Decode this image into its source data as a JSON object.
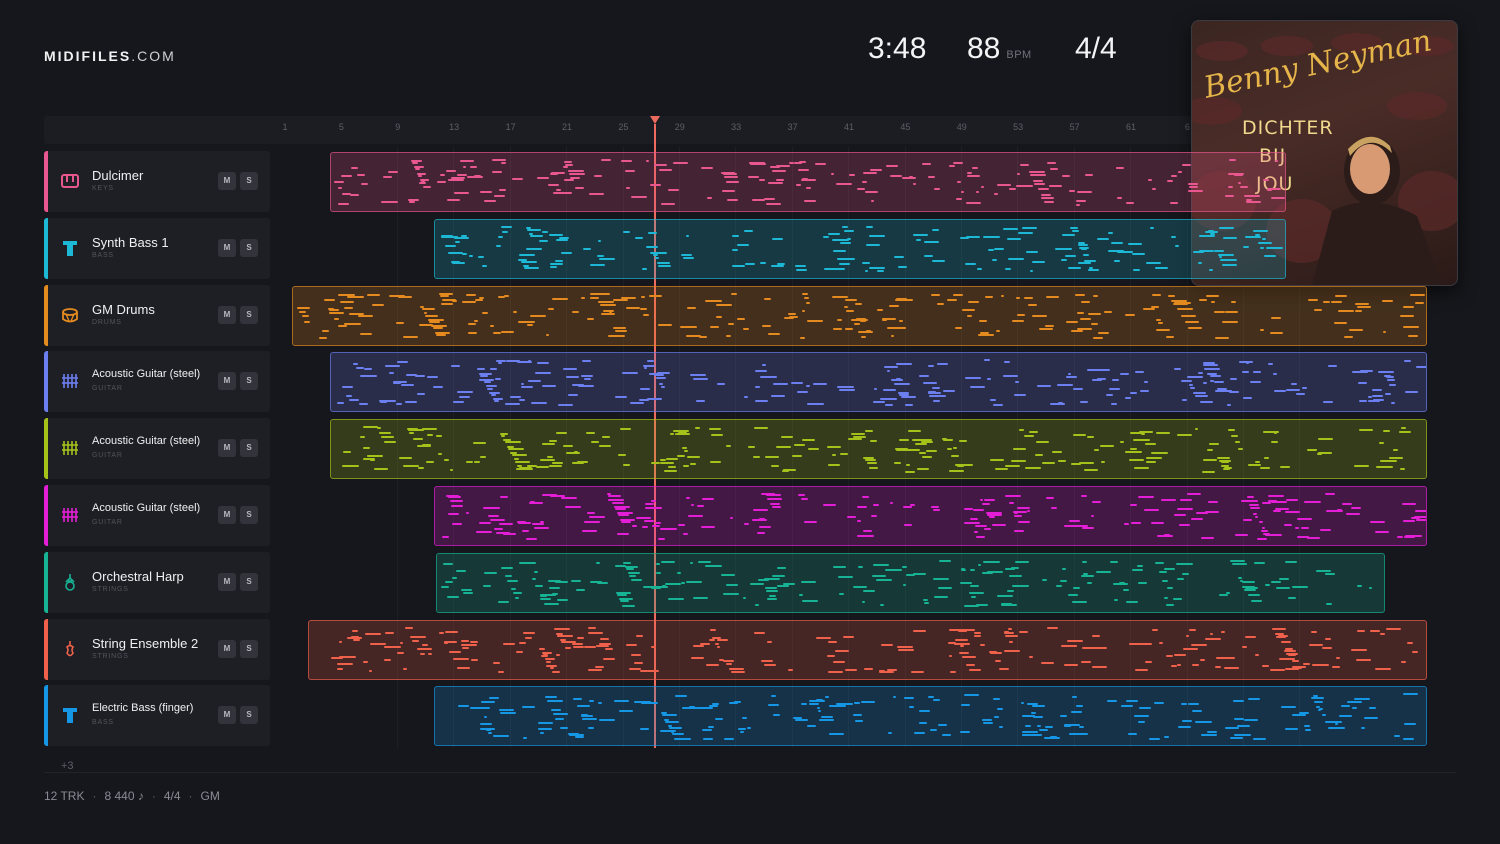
{
  "brand": {
    "bold": "MIDIFILES",
    "light": ".COM"
  },
  "transport": {
    "time": "3:48",
    "tempo": "88",
    "tempo_unit": "BPM",
    "meter": "4/4"
  },
  "ruler": {
    "bars": [
      "1",
      "5",
      "9",
      "13",
      "17",
      "21",
      "25",
      "29",
      "33",
      "37",
      "41",
      "45",
      "49",
      "53",
      "57",
      "61",
      "6"
    ]
  },
  "playhead_bar": 27,
  "tracks": [
    {
      "name": "Dulcimer",
      "category": "KEYS",
      "color": "#e8578f",
      "icon": "piano-icon",
      "mute": "M",
      "solo": "S"
    },
    {
      "name": "Synth Bass 1",
      "category": "BASS",
      "color": "#1cb8d6",
      "icon": "bass-icon",
      "mute": "M",
      "solo": "S"
    },
    {
      "name": "GM Drums",
      "category": "DRUMS",
      "color": "#e48a1f",
      "icon": "drum-icon",
      "mute": "M",
      "solo": "S"
    },
    {
      "name": "Acoustic Guitar (steel)",
      "category": "GUITAR",
      "color": "#6c7ff0",
      "icon": "guitar-icon",
      "mute": "M",
      "solo": "S"
    },
    {
      "name": "Acoustic Guitar (steel)",
      "category": "GUITAR",
      "color": "#a5c21b",
      "icon": "guitar-icon",
      "mute": "M",
      "solo": "S"
    },
    {
      "name": "Acoustic Guitar (steel)",
      "category": "GUITAR",
      "color": "#e31ed6",
      "icon": "guitar-icon",
      "mute": "M",
      "solo": "S"
    },
    {
      "name": "Orchestral Harp",
      "category": "STRINGS",
      "color": "#16b394",
      "icon": "harp-icon",
      "mute": "M",
      "solo": "S"
    },
    {
      "name": "String Ensemble 2",
      "category": "STRINGS",
      "color": "#f0614b",
      "icon": "violin-icon",
      "mute": "M",
      "solo": "S"
    },
    {
      "name": "Electric Bass (finger)",
      "category": "BASS",
      "color": "#1597e6",
      "icon": "bass-icon",
      "mute": "M",
      "solo": "S"
    }
  ],
  "more_tracks": "+3",
  "footer": {
    "tracks": "12 TRK",
    "notes": "8 440 ♪",
    "meter": "4/4",
    "standard": "GM"
  },
  "cover": {
    "artist": "Benny Neyman",
    "title_line1": "DICHTER",
    "title_line2": "BIJ",
    "title_line3": "JOU"
  }
}
